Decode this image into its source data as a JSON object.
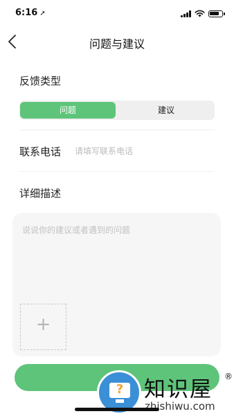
{
  "status_bar": {
    "time": "6:16",
    "location_glyph": "➚"
  },
  "nav": {
    "title": "问题与建议"
  },
  "feedback_type": {
    "label": "反馈类型",
    "options": [
      "问题",
      "建议"
    ],
    "selected": "问题",
    "accent_color": "#5ec47a"
  },
  "contact": {
    "label": "联系电话",
    "placeholder": "请填写联系电话",
    "value": ""
  },
  "description": {
    "label": "详细描述",
    "placeholder": "说说你的建议或者遇到的问题",
    "value": ""
  },
  "add_photo": {
    "glyph": "+"
  },
  "submit": {
    "label": ""
  },
  "watermark": {
    "brand": "知识屋",
    "url": "zhishiwu.com",
    "mark": "®",
    "glyph": "?"
  },
  "icons": [
    "location-arrow-icon",
    "signal-icon",
    "wifi-icon",
    "battery-icon",
    "back-chevron-icon",
    "add-photo-plus-icon",
    "watermark-monitor-icon"
  ]
}
